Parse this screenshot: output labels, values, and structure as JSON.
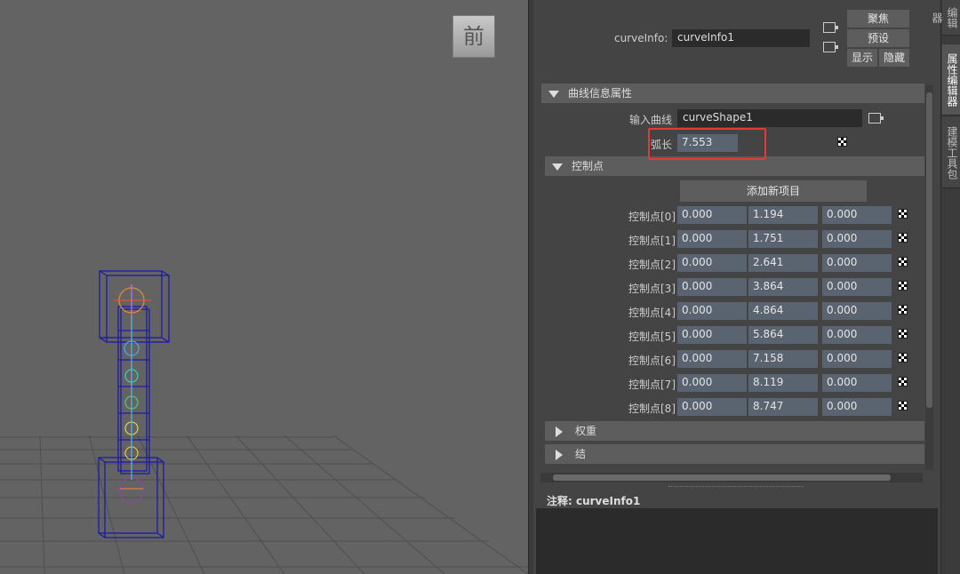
{
  "viewport": {
    "view_label": "前"
  },
  "node": {
    "label": "curveInfo:",
    "value": "curveInfo1"
  },
  "top_buttons": {
    "focus": "聚焦",
    "presets": "预设",
    "show": "显示",
    "hide": "隐藏"
  },
  "section_curve_info": {
    "title": "曲线信息属性",
    "input_curve_label": "输入曲线",
    "input_curve_value": "curveShape1",
    "arc_length_label": "弧长",
    "arc_length_value": "7.553"
  },
  "section_control_points": {
    "title": "控制点",
    "add_button": "添加新项目",
    "rows": [
      {
        "label": "控制点[0]",
        "x": "0.000",
        "y": "1.194",
        "z": "0.000"
      },
      {
        "label": "控制点[1]",
        "x": "0.000",
        "y": "1.751",
        "z": "0.000"
      },
      {
        "label": "控制点[2]",
        "x": "0.000",
        "y": "2.641",
        "z": "0.000"
      },
      {
        "label": "控制点[3]",
        "x": "0.000",
        "y": "3.864",
        "z": "0.000"
      },
      {
        "label": "控制点[4]",
        "x": "0.000",
        "y": "4.864",
        "z": "0.000"
      },
      {
        "label": "控制点[5]",
        "x": "0.000",
        "y": "5.864",
        "z": "0.000"
      },
      {
        "label": "控制点[6]",
        "x": "0.000",
        "y": "7.158",
        "z": "0.000"
      },
      {
        "label": "控制点[7]",
        "x": "0.000",
        "y": "8.119",
        "z": "0.000"
      },
      {
        "label": "控制点[8]",
        "x": "0.000",
        "y": "8.747",
        "z": "0.000"
      }
    ]
  },
  "section_weights": {
    "title": "权重"
  },
  "section_knots": {
    "title": "结"
  },
  "notes": {
    "label": "注释:  curveInfo1"
  },
  "side_tabs": {
    "tab1": "编辑器",
    "tab2": "属性编辑器",
    "tab3": "建模工具包"
  },
  "colors": {
    "highlight": "#e53935",
    "field_bg": "#5a6470"
  }
}
